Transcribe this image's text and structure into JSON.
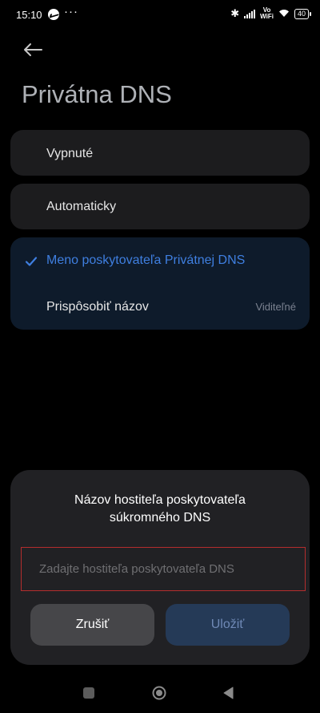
{
  "status_bar": {
    "time": "15:10",
    "overflow": "···",
    "volte_line1": "Vo",
    "volte_line2": "WiFi",
    "battery": "40"
  },
  "header": {
    "title": "Privátna DNS"
  },
  "options": {
    "off_label": "Vypnuté",
    "auto_label": "Automaticky",
    "provider_label": "Meno poskytovateľa Privátnej DNS",
    "customize_label": "Prispôsobiť názov",
    "customize_tag": "Viditeľné"
  },
  "dialog": {
    "title_line1": "Názov hostiteľa poskytovateľa",
    "title_line2": "súkromného DNS",
    "input_value": "",
    "input_placeholder": "Zadajte hostiteľa poskytovateľa DNS",
    "cancel_label": "Zrušiť",
    "save_label": "Uložiť"
  },
  "colors": {
    "accent": "#3f7fe0",
    "input_border": "#b42d2d"
  },
  "icons": {
    "back": "arrow-left-icon",
    "check": "checkmark-icon",
    "nav_recent": "square-icon",
    "nav_home": "circle-icon",
    "nav_back": "triangle-back-icon"
  }
}
